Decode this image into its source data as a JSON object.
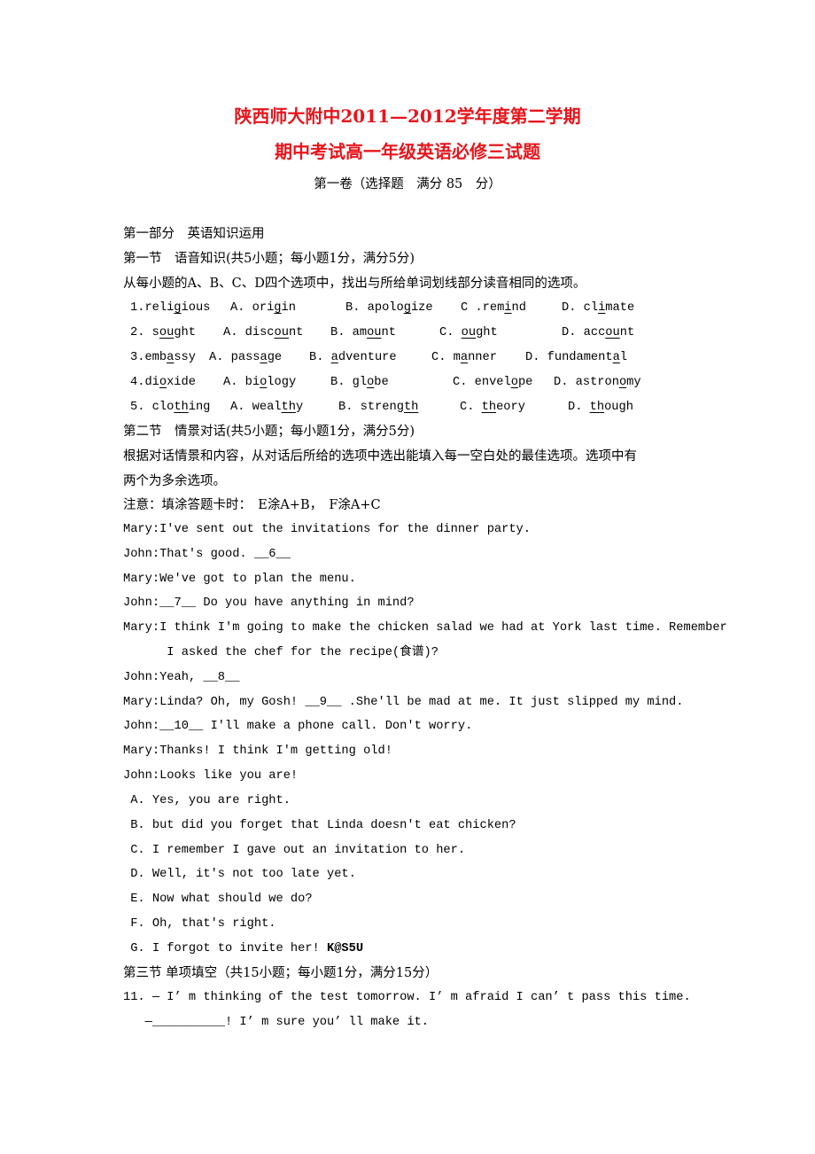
{
  "title_line1": "陕西师大附中2011—2012学年度第二学期",
  "title_line2": "期中考试高一年级英语必修三试题",
  "subtitle": "第一卷（选择题　满分 85　分）",
  "part1": "第一部分　英语知识运用",
  "sec1_title": "第一节　语音知识(共5小题；每小题1分，满分5分)",
  "sec1_instr": "从每小题的A、B、C、D四个选项中，找出与所给单词划线部分读音相同的选项。",
  "phonetics": [
    {
      "num": "1.",
      "word": [
        "reli",
        "g",
        "ious"
      ],
      "options": [
        [
          "A. ori",
          "g",
          "in"
        ],
        [
          "B. apolo",
          "g",
          "ize"
        ],
        [
          "C .rem",
          "i",
          "nd"
        ],
        [
          "D. cl",
          "i",
          "mate"
        ]
      ]
    },
    {
      "num": "2. ",
      "word": [
        "s",
        "ou",
        "ght"
      ],
      "options": [
        [
          "A. disc",
          "ou",
          "nt"
        ],
        [
          "B. am",
          "ou",
          "nt"
        ],
        [
          "C. ",
          "ou",
          "ght"
        ],
        [
          "D. acc",
          "ou",
          "nt"
        ]
      ]
    },
    {
      "num": "3.",
      "word": [
        "emb",
        "a",
        "ssy"
      ],
      "options": [
        [
          "A. pass",
          "a",
          "ge"
        ],
        [
          "B. ",
          "a",
          "dventure"
        ],
        [
          "C. m",
          "a",
          "nner"
        ],
        [
          "D. fundament",
          "a",
          "l"
        ]
      ]
    },
    {
      "num": "4.",
      "word": [
        "di",
        "o",
        "xide"
      ],
      "options": [
        [
          "A. bi",
          "o",
          "logy"
        ],
        [
          "B. gl",
          "o",
          "be"
        ],
        [
          "C. envel",
          "o",
          "pe"
        ],
        [
          "D. astron",
          "o",
          "my"
        ]
      ]
    },
    {
      "num": "5. ",
      "word": [
        "clo",
        "th",
        "ing"
      ],
      "options": [
        [
          "A. weal",
          "th",
          "y"
        ],
        [
          "B. streng",
          "th",
          ""
        ],
        [
          "C. ",
          "th",
          "eory"
        ],
        [
          "D. ",
          "th",
          "ough"
        ]
      ]
    }
  ],
  "sec2_title": "第二节　情景对话(共5小题；每小题1分，满分5分)",
  "sec2_instr1": "根据对话情景和内容，从对话后所给的选项中选出能填入每一空白处的最佳选项。选项中有",
  "sec2_instr2": "两个为多余选项。",
  "sec2_note": "注意：填涂答题卡时：　E涂A+B，　F涂A+C",
  "dialogue": [
    {
      "speaker": "Mary:",
      "pre": "I've sent out the invitations for the dinner party.",
      "blank": "",
      "post": ""
    },
    {
      "speaker": "John:",
      "pre": "That's good. ",
      "blank": "__6__",
      "post": ""
    },
    {
      "speaker": "Mary:",
      "pre": "We've got to plan the menu.",
      "blank": "",
      "post": ""
    },
    {
      "speaker": "John:",
      "pre": "",
      "blank": "__7__",
      "post": " Do you have anything in mind?"
    },
    {
      "speaker": "Mary:",
      "pre": "I think I'm going to make the chicken salad we had at York last time. Remember",
      "blank": "",
      "post": ""
    },
    {
      "speaker": "",
      "pre": "      I asked the chef for the recipe(食谱)?",
      "blank": "",
      "post": ""
    },
    {
      "speaker": "John:",
      "pre": "Yeah, ",
      "blank": "__8__",
      "post": ""
    },
    {
      "speaker": "Mary:",
      "pre": "Linda? Oh, my Gosh! ",
      "blank": "__9__",
      "post": " .She'll be mad at me. It just slipped my mind."
    },
    {
      "speaker": "John:",
      "pre": "",
      "blank": "__10__",
      "post": " I'll make a phone call. Don't worry."
    },
    {
      "speaker": "Mary:",
      "pre": "Thanks! I think I'm getting old!",
      "blank": "",
      "post": ""
    },
    {
      "speaker": "John:",
      "pre": "Looks like you are!",
      "blank": "",
      "post": ""
    }
  ],
  "choices": [
    " A. Yes, you are right.",
    " B. but did you forget that Linda doesn't eat chicken?",
    " C. I remember I gave out an invitation to her.",
    " D. Well, it's not too late yet.",
    " E. Now what should we do?",
    " F. Oh, that's right.",
    " G. I forgot to invite her! "
  ],
  "watermark": "K@S5U",
  "sec3_title": "第三节 单项填空（共15小题；每小题1分，满分15分）",
  "q11_line1": "11. — I’ m thinking of the test tomorrow. I’ m afraid I can’ t pass this time.",
  "q11_dash": "   —",
  "q11_blank": "__________",
  "q11_rest": "! I’ m sure you’ ll make it."
}
